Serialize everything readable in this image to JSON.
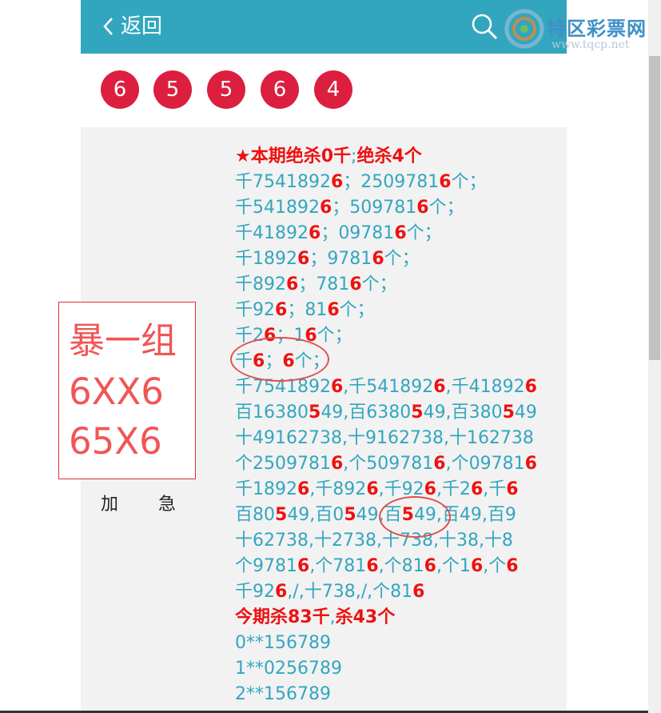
{
  "header": {
    "back_label": "返回"
  },
  "watermark": {
    "name": "特区彩票网",
    "url": "www.tqcp.net"
  },
  "balls": [
    "6",
    "5",
    "5",
    "6",
    "4"
  ],
  "highlight_box": {
    "line1": "暴一组",
    "line2": "6XX6",
    "line3": "65X6"
  },
  "tags": {
    "left": "加",
    "right": "急"
  },
  "colors": {
    "header_bg": "#33a6bf",
    "ball_bg": "#dc1f3f",
    "text_teal": "#33a6bf",
    "text_red": "#ee1111"
  },
  "lines": [
    [
      [
        "r",
        "★本期绝杀0千"
      ],
      [
        "n",
        ";"
      ],
      [
        "r",
        "绝杀4个"
      ]
    ],
    [
      [
        "n",
        "千7541892"
      ],
      [
        "r",
        "6"
      ],
      [
        "n",
        "；250978​1"
      ],
      [
        "r",
        "6"
      ],
      [
        "n",
        "个；"
      ]
    ],
    [
      [
        "n",
        "千541892"
      ],
      [
        "r",
        "6"
      ],
      [
        "n",
        "；50978​1"
      ],
      [
        "r",
        "6"
      ],
      [
        "n",
        "个；"
      ]
    ],
    [
      [
        "n",
        "千41892"
      ],
      [
        "r",
        "6"
      ],
      [
        "n",
        "；09781"
      ],
      [
        "r",
        "6"
      ],
      [
        "n",
        "个；"
      ]
    ],
    [
      [
        "n",
        "千1892"
      ],
      [
        "r",
        "6"
      ],
      [
        "n",
        "；9781"
      ],
      [
        "r",
        "6"
      ],
      [
        "n",
        "个；"
      ]
    ],
    [
      [
        "n",
        "千892"
      ],
      [
        "r",
        "6"
      ],
      [
        "n",
        "；781"
      ],
      [
        "r",
        "6"
      ],
      [
        "n",
        "个；"
      ]
    ],
    [
      [
        "n",
        "千92"
      ],
      [
        "r",
        "6"
      ],
      [
        "n",
        "；81"
      ],
      [
        "r",
        "6"
      ],
      [
        "n",
        "个；"
      ]
    ],
    [
      [
        "n",
        "千2"
      ],
      [
        "r",
        "6"
      ],
      [
        "n",
        "；1"
      ],
      [
        "r",
        "6"
      ],
      [
        "n",
        "个；"
      ]
    ],
    [
      [
        "n",
        "千"
      ],
      [
        "r",
        "6"
      ],
      [
        "n",
        "；"
      ],
      [
        "r",
        "6"
      ],
      [
        "n",
        "个；"
      ]
    ],
    [
      [
        "n",
        "千7541892"
      ],
      [
        "r",
        "6"
      ],
      [
        "n",
        ",千541892"
      ],
      [
        "r",
        "6"
      ],
      [
        "n",
        ",千41892"
      ],
      [
        "r",
        "6"
      ]
    ],
    [
      [
        "n",
        "百16380"
      ],
      [
        "r",
        "5"
      ],
      [
        "n",
        "49,百6380"
      ],
      [
        "r",
        "5"
      ],
      [
        "n",
        "49,百380"
      ],
      [
        "r",
        "5"
      ],
      [
        "n",
        "49"
      ]
    ],
    [
      [
        "n",
        "十49162738,十9162738,十162738"
      ]
    ],
    [
      [
        "n",
        "个250978​1"
      ],
      [
        "r",
        "6"
      ],
      [
        "n",
        ",个509781"
      ],
      [
        "r",
        "6"
      ],
      [
        "n",
        ",个09781"
      ],
      [
        "r",
        "6"
      ]
    ],
    [
      [
        "n",
        "千1892"
      ],
      [
        "r",
        "6"
      ],
      [
        "n",
        ",千892"
      ],
      [
        "r",
        "6"
      ],
      [
        "n",
        ",千92"
      ],
      [
        "r",
        "6"
      ],
      [
        "n",
        ",千2"
      ],
      [
        "r",
        "6"
      ],
      [
        "n",
        ",千"
      ],
      [
        "r",
        "6"
      ]
    ],
    [
      [
        "n",
        "百80"
      ],
      [
        "r",
        "5"
      ],
      [
        "n",
        "49,百0"
      ],
      [
        "r",
        "5"
      ],
      [
        "n",
        "49,百"
      ],
      [
        "r",
        "5"
      ],
      [
        "n",
        "49,百49,百9"
      ]
    ],
    [
      [
        "n",
        "十62738,十2738,十738,十38,十8"
      ]
    ],
    [
      [
        "n",
        "个9781"
      ],
      [
        "r",
        "6"
      ],
      [
        "n",
        ",个781"
      ],
      [
        "r",
        "6"
      ],
      [
        "n",
        ",个81"
      ],
      [
        "r",
        "6"
      ],
      [
        "n",
        ",个1"
      ],
      [
        "r",
        "6"
      ],
      [
        "n",
        ",个"
      ],
      [
        "r",
        "6"
      ]
    ],
    [
      [
        "n",
        "千92"
      ],
      [
        "r",
        "6"
      ],
      [
        "n",
        ",/,十738,/,个81"
      ],
      [
        "r",
        "6"
      ]
    ],
    [
      [
        "r",
        "今期杀83千"
      ],
      [
        "n",
        ","
      ],
      [
        "r",
        "杀43个"
      ]
    ],
    [
      [
        "n",
        "0**156789"
      ]
    ],
    [
      [
        "n",
        "1**0256789"
      ]
    ],
    [
      [
        "n",
        "2**156789"
      ]
    ]
  ]
}
